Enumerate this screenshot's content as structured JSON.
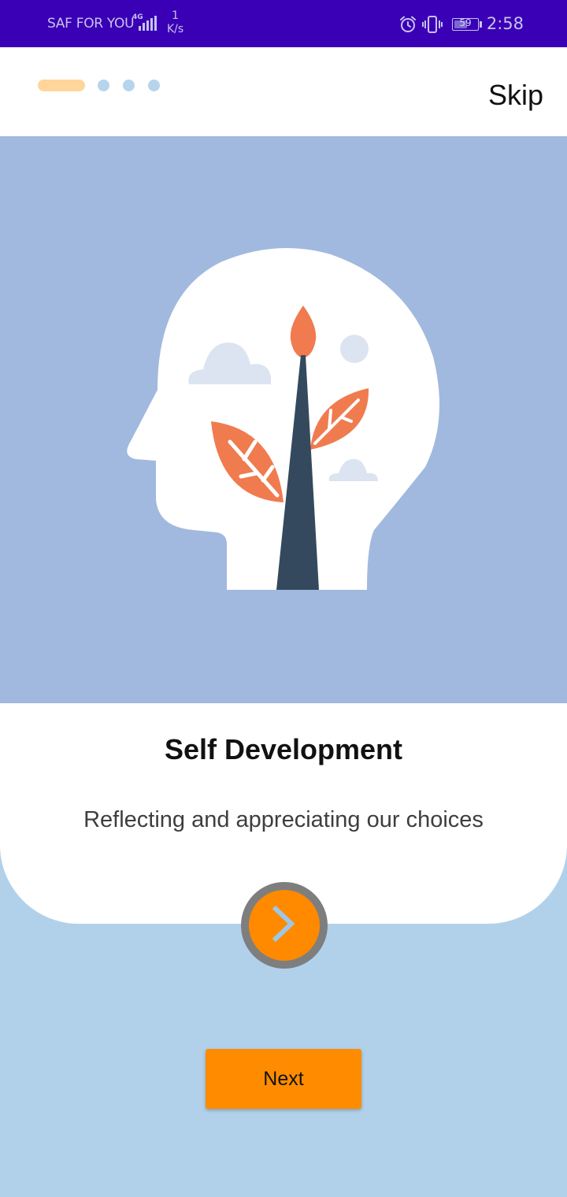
{
  "status_bar": {
    "carrier": "SAF FOR YOU",
    "network_type": "4G",
    "speed_value": "1",
    "speed_unit": "K/s",
    "battery": "59",
    "time": "2:58",
    "icons": [
      "signal-icon",
      "alarm-icon",
      "vibrate-icon",
      "battery-icon"
    ]
  },
  "onboarding": {
    "pages_total": 4,
    "current_page": 1,
    "skip_label": "Skip",
    "title": "Self Development",
    "subtitle": "Reflecting and appreciating our choices",
    "next_label": "Next",
    "fab_icon": "chevron-right-icon",
    "illustration": "head-with-plant-illustration"
  },
  "colors": {
    "status_bar": "#3a00b6",
    "hero_background": "#a1b9de",
    "page_background": "#b1d1eb",
    "accent": "#ff8c00",
    "indicator_active": "#ffd59b",
    "indicator_inactive": "#b6d4ec",
    "leaf": "#f07b4f",
    "trunk": "#34495e"
  }
}
